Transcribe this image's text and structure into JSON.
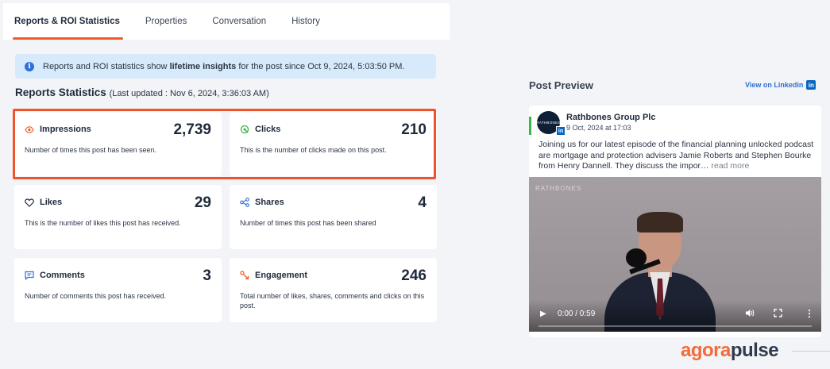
{
  "tabs": [
    {
      "label": "Reports & ROI Statistics",
      "active": true
    },
    {
      "label": "Properties",
      "active": false
    },
    {
      "label": "Conversation",
      "active": false
    },
    {
      "label": "History",
      "active": false
    }
  ],
  "info_banner": {
    "prefix": "Reports and ROI statistics show ",
    "bold": "lifetime insights",
    "suffix": " for the post since Oct 9, 2024, 5:03:50 PM."
  },
  "stats_section": {
    "title": "Reports Statistics",
    "updated": "(Last updated : Nov 6, 2024, 3:36:03 AM)"
  },
  "stats": [
    {
      "name": "Impressions",
      "value": "2,739",
      "description": "Number of times this post has been seen.",
      "icon": "eye-icon"
    },
    {
      "name": "Clicks",
      "value": "210",
      "description": "This is the number of clicks made on this post.",
      "icon": "click-icon"
    },
    {
      "name": "Likes",
      "value": "29",
      "description": "This is the number of likes this post has received.",
      "icon": "heart-icon"
    },
    {
      "name": "Shares",
      "value": "4",
      "description": "Number of times this post has been shared",
      "icon": "share-icon"
    },
    {
      "name": "Comments",
      "value": "3",
      "description": "Number of comments this post has received.",
      "icon": "comment-icon"
    },
    {
      "name": "Engagement",
      "value": "246",
      "description": "Total number of likes, shares, comments and clicks on this post.",
      "icon": "engagement-icon"
    }
  ],
  "preview": {
    "title": "Post Preview",
    "view_link": "View on Linkedin",
    "author": "Rathbones Group Plc",
    "avatar_text": "RATHBONES",
    "date": "9 Oct, 2024 at 17:03",
    "text": "Joining us for our latest episode of the financial planning unlocked podcast are mortgage and protection advisers Jamie Roberts and Stephen Bourke from Henry Dannell. They discuss the impor…",
    "more": "read more",
    "video_watermark": "RATHBONES",
    "video_time": "0:00 / 0:59",
    "video_progress": 0
  },
  "brand": {
    "part1": "agora",
    "part2": "pulse"
  },
  "colors": {
    "accent": "#ef5a27",
    "info_bg": "#d7eafb",
    "link": "#2f6fd6",
    "linkedin": "#0a66c2"
  }
}
